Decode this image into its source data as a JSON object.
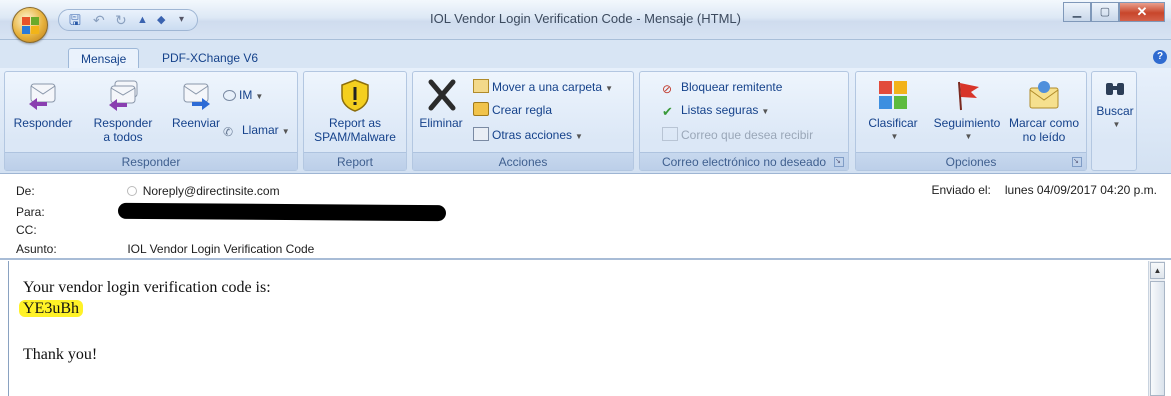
{
  "window": {
    "title": "IOL Vendor Login Verification Code - Mensaje (HTML)",
    "minimize_glyph": "▁",
    "maximize_glyph": "▢",
    "close_glyph": "✕"
  },
  "tabs": [
    {
      "label": "Mensaje",
      "active": true
    },
    {
      "label": "PDF-XChange V6",
      "active": false
    }
  ],
  "ribbon": {
    "responder": {
      "group_label": "Responder",
      "reply": "Responder",
      "reply_all_line1": "Responder",
      "reply_all_line2": "a todos",
      "forward": "Reenviar",
      "im": "IM",
      "call": "Llamar"
    },
    "report": {
      "group_label": "Report",
      "button_line1": "Report as",
      "button_line2": "SPAM/Malware"
    },
    "acciones": {
      "group_label": "Acciones",
      "delete": "Eliminar",
      "move": "Mover a una carpeta",
      "create_rule": "Crear regla",
      "other_actions": "Otras acciones"
    },
    "junk": {
      "group_label": "Correo electrónico no deseado",
      "block_sender": "Bloquear remitente",
      "safe_lists": "Listas seguras",
      "not_junk": "Correo que desea recibir"
    },
    "opciones": {
      "group_label": "Opciones",
      "categorize": "Clasificar",
      "follow_up": "Seguimiento",
      "mark_unread_line1": "Marcar como",
      "mark_unread_line2": "no leído"
    },
    "find": {
      "label": "Buscar"
    }
  },
  "header": {
    "from_label": "De:",
    "from_value": "Noreply@directinsite.com",
    "to_label": "Para:",
    "cc_label": "CC:",
    "subject_label": "Asunto:",
    "subject_value": "IOL Vendor Login Verification Code",
    "sent_label": "Enviado el:",
    "sent_value": "lunes 04/09/2017 04:20 p.m."
  },
  "body": {
    "line1": "Your vendor login verification code is:",
    "code": "YE3uBh",
    "closing": "Thank you!"
  },
  "colors": {
    "ribbon_text": "#15428b",
    "highlight": "#fff227"
  }
}
